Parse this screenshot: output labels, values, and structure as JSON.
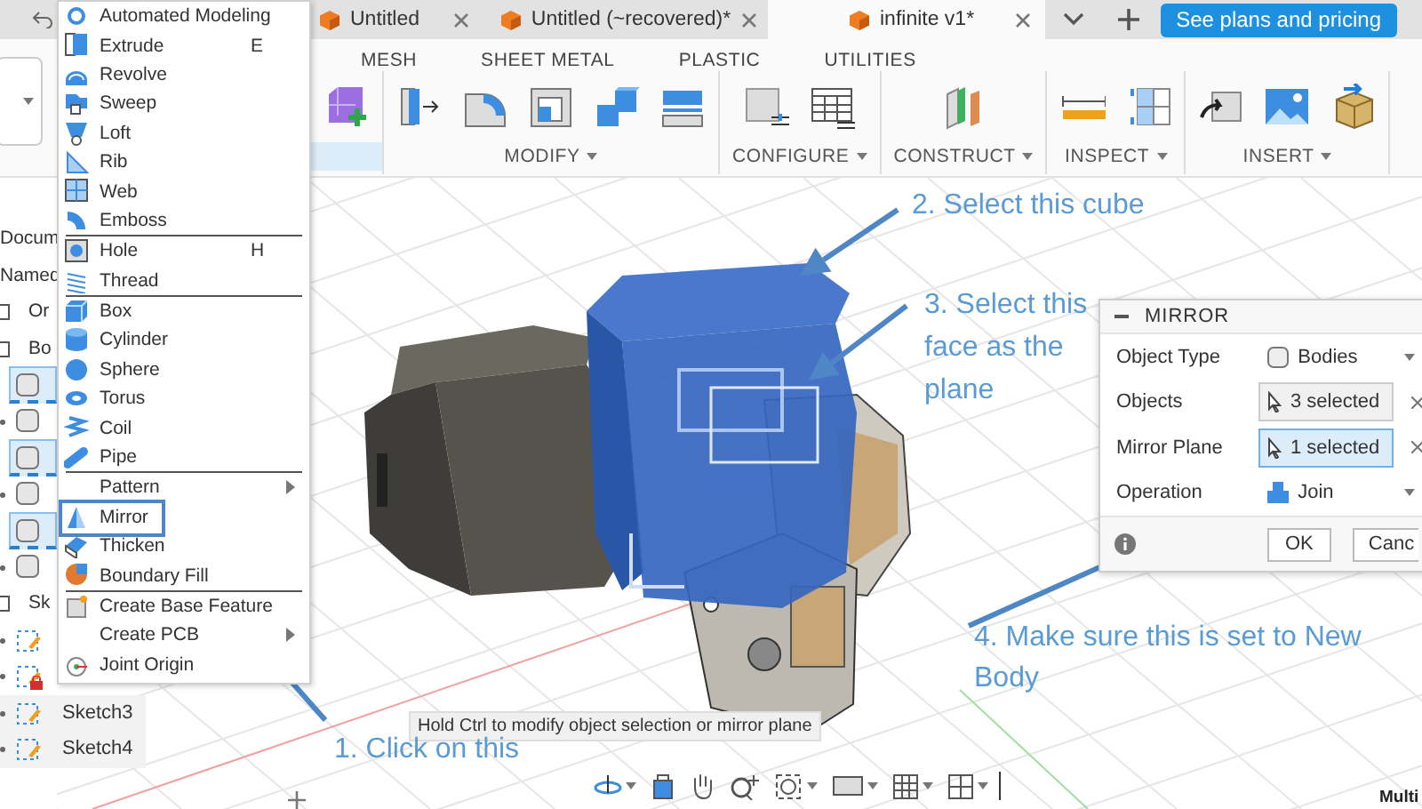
{
  "tab_bar": {
    "tabs": [
      {
        "title": "Untitled",
        "selected": false
      },
      {
        "title": "Untitled (~recovered)*",
        "selected": false
      },
      {
        "title": "infinite v1*",
        "selected": true
      }
    ],
    "plans_button": "See plans and pricing"
  },
  "toolbar": {
    "tabs": [
      "MESH",
      "SHEET METAL",
      "PLASTIC",
      "UTILITIES"
    ],
    "groups": [
      "MODIFY",
      "CONFIGURE",
      "CONSTRUCT",
      "INSPECT",
      "INSERT"
    ]
  },
  "browser": {
    "rows": [
      {
        "kind": "label",
        "text": "Docum"
      },
      {
        "kind": "label",
        "text": "Named"
      },
      {
        "kind": "folder",
        "text": "Or"
      },
      {
        "kind": "folder",
        "text": "Bo"
      },
      {
        "kind": "body",
        "selected": true
      },
      {
        "kind": "body",
        "selected": false
      },
      {
        "kind": "body",
        "selected": true
      },
      {
        "kind": "body",
        "selected": false
      },
      {
        "kind": "body",
        "selected": true
      },
      {
        "kind": "body",
        "selected": false
      },
      {
        "kind": "folder",
        "text": "Sk"
      },
      {
        "kind": "sketch",
        "locked": false
      },
      {
        "kind": "sketch",
        "locked": true
      },
      {
        "kind": "sketch",
        "text": "Sketch3",
        "locked": false
      },
      {
        "kind": "sketch",
        "text": "Sketch4",
        "locked": false
      }
    ]
  },
  "menu": {
    "groups": [
      {
        "items": [
          {
            "label": "Automated Modeling",
            "submenu": false,
            "highlighted": false
          },
          {
            "label": "Extrude",
            "shortcut": "E",
            "submenu": false,
            "highlighted": false
          },
          {
            "label": "Revolve",
            "submenu": false,
            "highlighted": false
          },
          {
            "label": "Sweep",
            "submenu": false,
            "highlighted": false
          },
          {
            "label": "Loft",
            "submenu": false,
            "highlighted": false
          },
          {
            "label": "Rib",
            "submenu": false,
            "highlighted": false
          },
          {
            "label": "Web",
            "submenu": false,
            "highlighted": false
          },
          {
            "label": "Emboss",
            "submenu": false,
            "highlighted": false
          }
        ]
      },
      {
        "items": [
          {
            "label": "Hole",
            "shortcut": "H",
            "submenu": false,
            "highlighted": false
          },
          {
            "label": "Thread",
            "submenu": false,
            "highlighted": false
          }
        ]
      },
      {
        "items": [
          {
            "label": "Box",
            "submenu": false,
            "highlighted": false
          },
          {
            "label": "Cylinder",
            "submenu": false,
            "highlighted": false
          },
          {
            "label": "Sphere",
            "submenu": false,
            "highlighted": false
          },
          {
            "label": "Torus",
            "submenu": false,
            "highlighted": false
          },
          {
            "label": "Coil",
            "submenu": false,
            "highlighted": false
          },
          {
            "label": "Pipe",
            "submenu": false,
            "highlighted": false
          }
        ]
      },
      {
        "items": [
          {
            "label": "Pattern",
            "submenu": true,
            "highlighted": false
          },
          {
            "label": "Mirror",
            "submenu": false,
            "highlighted": true
          },
          {
            "label": "Thicken",
            "submenu": false,
            "highlighted": false
          },
          {
            "label": "Boundary Fill",
            "submenu": false,
            "highlighted": false
          }
        ]
      },
      {
        "items": [
          {
            "label": "Create Base Feature",
            "submenu": false,
            "highlighted": false
          },
          {
            "label": "Create PCB",
            "submenu": true,
            "highlighted": false
          },
          {
            "label": "Joint Origin",
            "submenu": false,
            "highlighted": false
          }
        ]
      }
    ]
  },
  "mirror_dialog": {
    "title": "MIRROR",
    "rows": [
      {
        "label": "Object Type",
        "kind": "dropdown",
        "value": "Bodies"
      },
      {
        "label": "Objects",
        "kind": "selection",
        "value": "3 selected",
        "active": false
      },
      {
        "label": "Mirror Plane",
        "kind": "selection",
        "value": "1 selected",
        "active": true
      },
      {
        "label": "Operation",
        "kind": "dropdown",
        "value": "Join"
      }
    ],
    "buttons": [
      "OK",
      "Canc"
    ]
  },
  "tooltip": "Hold Ctrl to modify object selection or mirror plane",
  "annotations": [
    {
      "text": "1. Click on this"
    },
    {
      "text": "2. Select this cube"
    },
    {
      "text": "3. Select this face as the plane"
    },
    {
      "text": "4. Make sure this is set to New Body"
    }
  ],
  "status_text": "Multi"
}
